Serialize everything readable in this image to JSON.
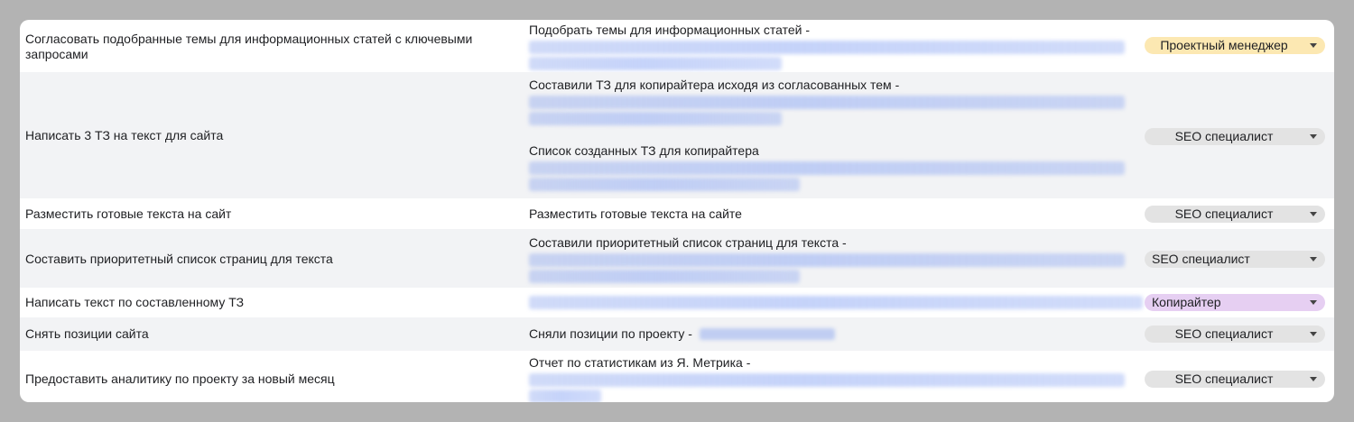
{
  "rows": [
    {
      "task": "Согласовать подобранные темы для информационных статей с ключевыми запросами",
      "result_text": "Подобрать темы для информационных статей -",
      "role": "Проектный менеджер"
    },
    {
      "task": "Написать 3 ТЗ на текст для сайта",
      "result_text": "Составили ТЗ для копирайтера исходя из согласованных тем -",
      "result_text2": "Список созданных ТЗ для копирайтера",
      "role": "SEO специалист"
    },
    {
      "task": "Разместить готовые текста на сайт",
      "result_text": "Разместить готовые текста на сайте",
      "role": "SEO специалист"
    },
    {
      "task": "Составить приоритетный список страниц для текста",
      "result_text": "Составили приоритетный список страниц для текста -",
      "role": "SEO специалист"
    },
    {
      "task": "Написать текст по составленному ТЗ",
      "role": "Копирайтер"
    },
    {
      "task": "Снять позиции сайта",
      "result_text": "Сняли позиции по проекту -",
      "role": "SEO специалист"
    },
    {
      "task": "Предоставить аналитику по проекту за новый месяц",
      "result_text": "Отчет по статистикам из Я. Метрика -",
      "role": "SEO специалист"
    }
  ],
  "colors": {
    "page_background": "#b3b3b3",
    "row_alt": "#f2f3f5",
    "chip_default": "#e3e3e3",
    "chip_project_manager": "#fce8b2",
    "chip_copywriter": "#e6cff2"
  }
}
